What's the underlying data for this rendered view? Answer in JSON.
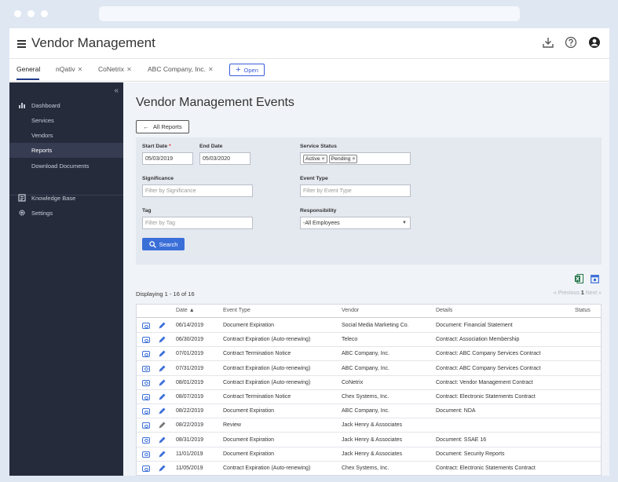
{
  "app": {
    "title": "Vendor Management"
  },
  "header_icons": [
    "download-icon",
    "help-icon",
    "user-icon"
  ],
  "tabs": [
    {
      "label": "General",
      "closable": false,
      "active": true
    },
    {
      "label": "nQativ",
      "closable": true
    },
    {
      "label": "CoNetrix",
      "closable": true
    },
    {
      "label": "ABC Company, Inc.",
      "closable": true
    }
  ],
  "open_button": "Open",
  "sidebar": {
    "collapse_glyph": "«",
    "items": [
      {
        "label": "Dashboard",
        "icon": "chart-icon"
      },
      {
        "label": "Services"
      },
      {
        "label": "Vendors"
      },
      {
        "label": "Reports",
        "active": true
      },
      {
        "label": "Download Documents"
      },
      {
        "label": "Knowledge Base",
        "icon": "book-icon"
      },
      {
        "label": "Settings",
        "icon": "gear-icon"
      }
    ]
  },
  "page": {
    "title": "Vendor Management Events",
    "back_button": "All Reports"
  },
  "filters": {
    "start_date_label": "Start Date",
    "start_date_required": "*",
    "start_date": "05/03/2019",
    "end_date_label": "End Date",
    "end_date": "05/03/2020",
    "service_status_label": "Service Status",
    "service_status_chips": [
      "Active",
      "Pending"
    ],
    "chip_remove": "×",
    "significance_label": "Significance",
    "significance_placeholder": "Filter by Significance",
    "event_type_label": "Event Type",
    "event_type_placeholder": "Filter by Event Type",
    "tag_label": "Tag",
    "tag_placeholder": "Filter by Tag",
    "responsibility_label": "Responsibility",
    "responsibility_value": "-All Employees",
    "search_button": "Search"
  },
  "results": {
    "displaying": "Displaying 1 - 16 of 16",
    "pager_prev": "« Previous",
    "pager_page": "1",
    "pager_next": "Next »"
  },
  "table": {
    "columns": [
      "Date ▲",
      "Event Type",
      "Vendor",
      "Details",
      "Status"
    ],
    "rows": [
      [
        "06/14/2019",
        "Document Expiration",
        "Social Media Marketing Co.",
        "Document: Financial Statement",
        ""
      ],
      [
        "06/30/2019",
        "Contract Expiration (Auto-renewing)",
        "Teleco",
        "Contract: Association Membership",
        ""
      ],
      [
        "07/01/2019",
        "Contract Termination Notice",
        "ABC Company, Inc.",
        "Contract: ABC Company Services Contract",
        ""
      ],
      [
        "07/31/2019",
        "Contract Expiration (Auto-renewing)",
        "ABC Company, Inc.",
        "Contract: ABC Company Services Contract",
        ""
      ],
      [
        "08/01/2019",
        "Contract Expiration (Auto-renewing)",
        "CoNetrix",
        "Contract: Vendor Management Contract",
        ""
      ],
      [
        "08/07/2019",
        "Contract Termination Notice",
        "Chex Systems, Inc.",
        "Contract: Electronic Statements Contract",
        ""
      ],
      [
        "08/22/2019",
        "Document Expiration",
        "ABC Company, Inc.",
        "Document: NDA",
        ""
      ],
      [
        "08/22/2019",
        "Review",
        "Jack Henry & Associates",
        "",
        ""
      ],
      [
        "08/31/2019",
        "Document Expiration",
        "Jack Henry & Associates",
        "Document: SSAE 16",
        ""
      ],
      [
        "11/01/2019",
        "Document Expiration",
        "Jack Henry & Associates",
        "Document: Security Reports",
        ""
      ],
      [
        "11/05/2019",
        "Contract Expiration (Auto-renewing)",
        "Chex Systems, Inc.",
        "Contract: Electronic Statements Contract",
        ""
      ]
    ],
    "edit_icon_colors": [
      "#3b6fd8",
      "#3b6fd8",
      "#3b6fd8",
      "#3b6fd8",
      "#3b6fd8",
      "#3b6fd8",
      "#3b6fd8",
      "#777777",
      "#3b6fd8",
      "#3b6fd8",
      "#3b6fd8"
    ]
  },
  "colors": {
    "accent": "#3b6fd8",
    "sidebar_bg": "#262b3c",
    "excel_green": "#1e7145"
  }
}
